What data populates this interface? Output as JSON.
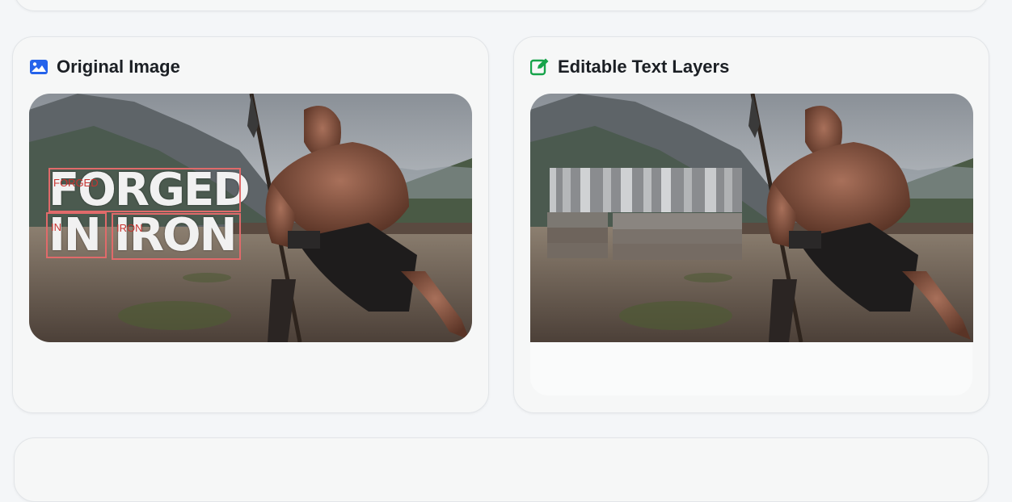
{
  "left_card": {
    "title": "Original Image",
    "icon": "image-icon",
    "icon_color": "#2563eb",
    "ocr_boxes": [
      {
        "label": "FORGED",
        "text": "FORGED"
      },
      {
        "label": "IN",
        "text": "IN"
      },
      {
        "label": "IRON",
        "text": "IRON"
      }
    ]
  },
  "right_card": {
    "title": "Editable Text Layers",
    "icon": "edit-icon",
    "icon_color": "#16a34a"
  },
  "colors": {
    "box_outline": "#e06a6a",
    "box_label": "#c8332f"
  }
}
